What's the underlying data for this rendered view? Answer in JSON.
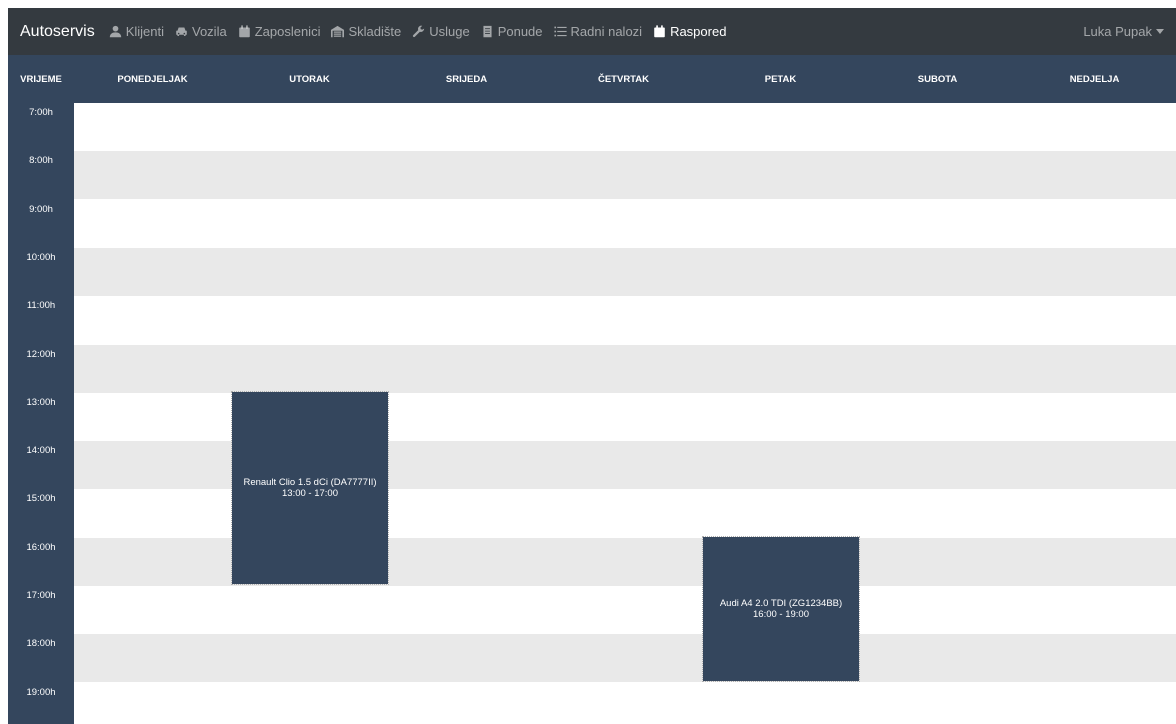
{
  "navbar": {
    "brand": "Autoservis",
    "items": [
      {
        "label": "Klijenti",
        "icon": "user-icon",
        "active": false
      },
      {
        "label": "Vozila",
        "icon": "car-icon",
        "active": false
      },
      {
        "label": "Zaposlenici",
        "icon": "calendar-icon",
        "active": false
      },
      {
        "label": "Skladište",
        "icon": "warehouse-icon",
        "active": false
      },
      {
        "label": "Usluge",
        "icon": "wrench-icon",
        "active": false
      },
      {
        "label": "Ponude",
        "icon": "document-icon",
        "active": false
      },
      {
        "label": "Radni nalozi",
        "icon": "list-icon",
        "active": false
      },
      {
        "label": "Raspored",
        "icon": "calendar-icon",
        "active": true
      }
    ],
    "user": "Luka Pupak"
  },
  "schedule": {
    "headers": {
      "time": "VRIJEME",
      "days": [
        "PONEDJELJAK",
        "UTORAK",
        "SRIJEDA",
        "ČETVRTAK",
        "PETAK",
        "SUBOTA",
        "NEDJELJA"
      ]
    },
    "hours": [
      "7:00h",
      "8:00h",
      "9:00h",
      "10:00h",
      "11:00h",
      "12:00h",
      "13:00h",
      "14:00h",
      "15:00h",
      "16:00h",
      "17:00h",
      "18:00h",
      "19:00h"
    ],
    "events": [
      {
        "day": "UTORAK",
        "start": "13:00",
        "end": "17:00",
        "title": "Renault Clio 1.5 dCi (DA7777II)",
        "time_range": "13:00 - 17:00"
      },
      {
        "day": "PETAK",
        "start": "16:00",
        "end": "19:00",
        "title": "Audi A4 2.0 TDI (ZG1234BB)",
        "time_range": "16:00 - 19:00"
      }
    ]
  },
  "colors": {
    "navbar_bg": "#343a40",
    "schedule_header_bg": "#34465d",
    "event_bg": "#34465d",
    "row_alt_bg": "#e9e9e9"
  }
}
